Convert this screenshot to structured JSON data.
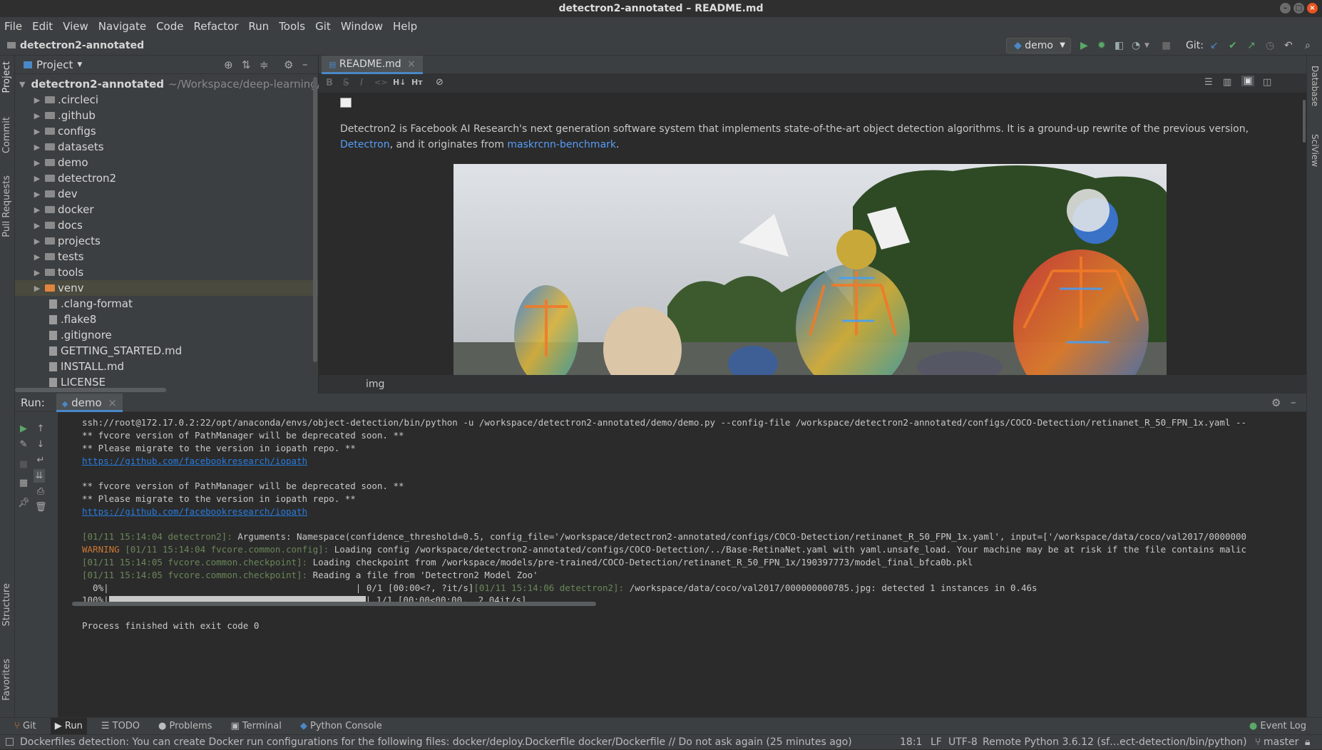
{
  "window": {
    "title": "detectron2-annotated – README.md"
  },
  "menu": [
    "File",
    "Edit",
    "View",
    "Navigate",
    "Code",
    "Refactor",
    "Run",
    "Tools",
    "Git",
    "Window",
    "Help"
  ],
  "nav": {
    "project": "detectron2-annotated",
    "run_config": "demo",
    "git_label": "Git:"
  },
  "left_tabs": {
    "project": "Project",
    "commit": "Commit",
    "pull_requests": "Pull Requests",
    "structure": "Structure",
    "favorites": "Favorites"
  },
  "right_tabs": {
    "database": "Database",
    "sciview": "SciView"
  },
  "project_panel": {
    "title": "Project",
    "root": {
      "name": "detectron2-annotated",
      "path": "~/Workspace/deep-learning/gr"
    },
    "folders": [
      ".circleci",
      ".github",
      "configs",
      "datasets",
      "demo",
      "detectron2",
      "dev",
      "docker",
      "docs",
      "projects",
      "tests",
      "tools",
      "venv"
    ],
    "files": [
      ".clang-format",
      ".flake8",
      ".gitignore",
      "GETTING_STARTED.md",
      "INSTALL.md",
      "LICENSE"
    ]
  },
  "editor": {
    "tab": "README.md",
    "md_tools": [
      "B",
      "S",
      "I",
      "<>",
      "H↓",
      "Hᴛ",
      "⊘"
    ],
    "intro_part1": "Detectron2 is Facebook AI Research's next generation software system that implements state-of-the-art object detection algorithms. It is a ground-up rewrite of the previous version, ",
    "link1": "Detectron",
    "intro_part2": ", and it originates from ",
    "link2": "maskrcnn-benchmark",
    "intro_part3": ".",
    "image_caption": "img"
  },
  "run": {
    "label": "Run:",
    "tab": "demo",
    "lines": [
      {
        "parts": [
          {
            "t": "ssh://root@172.17.0.2:22/opt/anaconda/envs/object-detection/bin/python -u /workspace/detectron2-annotated/demo/demo.py --config-file /workspace/detectron2-annotated/configs/COCO-Detection/retinanet_R_50_FPN_1x.yaml --",
            "c": ""
          }
        ]
      },
      {
        "parts": [
          {
            "t": "** fvcore version of PathManager will be deprecated soon. **",
            "c": ""
          }
        ]
      },
      {
        "parts": [
          {
            "t": "** Please migrate to the version in iopath repo. **",
            "c": ""
          }
        ]
      },
      {
        "parts": [
          {
            "t": "https://github.com/facebookresearch/iopath",
            "c": "cu"
          }
        ]
      },
      {
        "parts": [
          {
            "t": "",
            "c": ""
          }
        ]
      },
      {
        "parts": [
          {
            "t": "** fvcore version of PathManager will be deprecated soon. **",
            "c": ""
          }
        ]
      },
      {
        "parts": [
          {
            "t": "** Please migrate to the version in iopath repo. **",
            "c": ""
          }
        ]
      },
      {
        "parts": [
          {
            "t": "https://github.com/facebookresearch/iopath",
            "c": "cu"
          }
        ]
      },
      {
        "parts": [
          {
            "t": "",
            "c": ""
          }
        ]
      },
      {
        "parts": [
          {
            "t": "[01/11 15:14:04 detectron2]: ",
            "c": "cg"
          },
          {
            "t": "Arguments: Namespace(confidence_threshold=0.5, config_file='/workspace/detectron2-annotated/configs/COCO-Detection/retinanet_R_50_FPN_1x.yaml', input=['/workspace/data/coco/val2017/0000000",
            "c": ""
          }
        ]
      },
      {
        "parts": [
          {
            "t": "WARNING ",
            "c": "cw"
          },
          {
            "t": "[01/11 15:14:04 fvcore.common.config]: ",
            "c": "cg"
          },
          {
            "t": "Loading config /workspace/detectron2-annotated/configs/COCO-Detection/../Base-RetinaNet.yaml with yaml.unsafe_load. Your machine may be at risk if the file contains malic",
            "c": ""
          }
        ]
      },
      {
        "parts": [
          {
            "t": "[01/11 15:14:05 fvcore.common.checkpoint]: ",
            "c": "cg"
          },
          {
            "t": "Loading checkpoint from /workspace/models/pre-trained/COCO-Detection/retinanet_R_50_FPN_1x/190397773/model_final_bfca0b.pkl",
            "c": ""
          }
        ]
      },
      {
        "parts": [
          {
            "t": "[01/11 15:14:05 fvcore.common.checkpoint]: ",
            "c": "cg"
          },
          {
            "t": "Reading a file from 'Detectron2 Model Zoo'",
            "c": ""
          }
        ]
      },
      {
        "parts": [
          {
            "t": "  0%|                                              | 0/1 [00:00<?, ?it/s]",
            "c": ""
          },
          {
            "t": "[01/11 15:14:06 detectron2]: ",
            "c": "cg"
          },
          {
            "t": "/workspace/data/coco/val2017/000000000785.jpg: detected 1 instances in 0.46s",
            "c": ""
          }
        ]
      },
      {
        "progress": true,
        "prefix": "100%|",
        "suffix": "| 1/1 [00:00<00:00,  2.04it/s]",
        "fraction": 1.0
      },
      {
        "parts": [
          {
            "t": "",
            "c": ""
          }
        ]
      },
      {
        "parts": [
          {
            "t": "Process finished with exit code 0",
            "c": ""
          }
        ]
      }
    ]
  },
  "bottom_tabs": {
    "git": "Git",
    "run": "Run",
    "todo": "TODO",
    "problems": "Problems",
    "terminal": "Terminal",
    "python_console": "Python Console",
    "event_log": "Event Log"
  },
  "status": {
    "message": "Dockerfiles detection: You can create Docker run configurations for the following files: docker/deploy.Dockerfile docker/Dockerfile // Do not ask again (25 minutes ago)",
    "position": "18:1",
    "line_sep": "LF",
    "encoding": "UTF-8",
    "interpreter": "Remote Python 3.6.12 (sf…ect-detection/bin/python)",
    "branch": "master"
  },
  "colors": {
    "accent": "#4a88c7",
    "link": "#589df6",
    "log_green": "#6a8759",
    "warning": "#cc7832",
    "run_green": "#59a869"
  }
}
